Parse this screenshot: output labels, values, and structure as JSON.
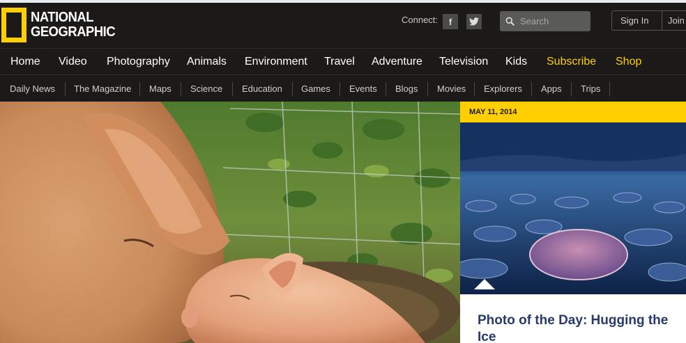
{
  "brand": {
    "line1": "NATIONAL",
    "line2": "GEOGRAPHIC",
    "color": "#ffcf01"
  },
  "header": {
    "connect_label": "Connect:",
    "social": [
      {
        "icon": "facebook-icon",
        "glyph": "f"
      },
      {
        "icon": "twitter-icon",
        "glyph": "t"
      }
    ],
    "search_placeholder": "Search",
    "sign_in": "Sign In",
    "join": "Join"
  },
  "main_nav": [
    "Home",
    "Video",
    "Photography",
    "Animals",
    "Environment",
    "Travel",
    "Adventure",
    "Television",
    "Kids",
    "Subscribe",
    "Shop"
  ],
  "sub_nav": [
    "Daily News",
    "The Magazine",
    "Maps",
    "Science",
    "Education",
    "Games",
    "Events",
    "Blogs",
    "Movies",
    "Explorers",
    "Apps",
    "Trips"
  ],
  "photo_of_day": {
    "date": "MAY 11, 2014",
    "title": "Photo of the Day: Hugging the Ice"
  },
  "colors": {
    "accent": "#ffcf01",
    "background": "#1b1a18",
    "title": "#253a6d"
  }
}
